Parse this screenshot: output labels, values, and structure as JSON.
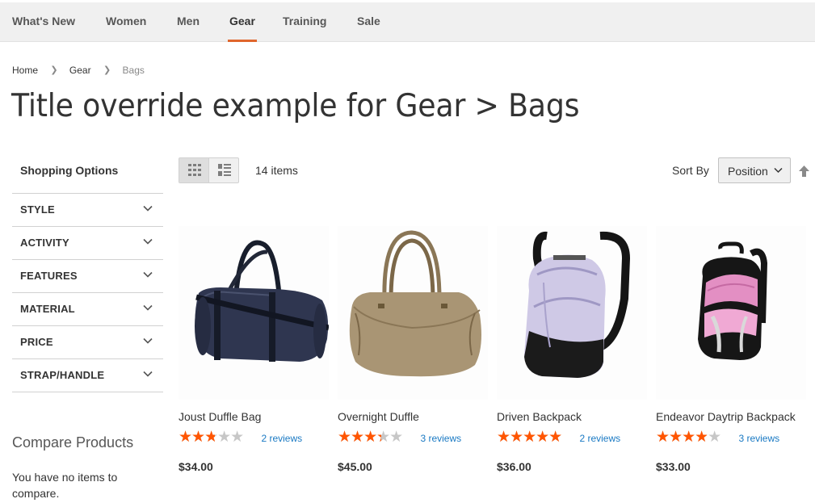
{
  "nav": {
    "items": [
      {
        "label": "What's New"
      },
      {
        "label": "Women"
      },
      {
        "label": "Men"
      },
      {
        "label": "Gear",
        "active": true
      },
      {
        "label": "Training"
      },
      {
        "label": "Sale"
      }
    ]
  },
  "breadcrumbs": [
    "Home",
    "Gear",
    "Bags"
  ],
  "page_title": "Title override example for Gear > Bags",
  "sidebar": {
    "title": "Shopping Options",
    "filters": [
      "STYLE",
      "ACTIVITY",
      "FEATURES",
      "MATERIAL",
      "PRICE",
      "STRAP/HANDLE"
    ],
    "compare_title": "Compare Products",
    "compare_text": "You have no items to compare."
  },
  "toolbar": {
    "modes": [
      "grid-icon",
      "list-icon"
    ],
    "active_mode": "grid",
    "amount": "14 items",
    "sort_label": "Sort By",
    "sort_value": "Position",
    "sort_direction": "ascending"
  },
  "products": [
    {
      "name": "Joust Duffle Bag",
      "rating": 0.5,
      "reviews": "2 reviews",
      "price": "$34.00",
      "image_icon": "duffle-bag-navy"
    },
    {
      "name": "Overnight Duffle",
      "rating": 0.6,
      "reviews": "3 reviews",
      "price": "$45.00",
      "image_icon": "duffle-bag-tan"
    },
    {
      "name": "Driven Backpack",
      "rating": 0.9,
      "reviews": "2 reviews",
      "price": "$36.00",
      "image_icon": "backpack-lavender"
    },
    {
      "name": "Endeavor Daytrip Backpack",
      "rating": 0.7,
      "reviews": "3 reviews",
      "price": "$33.00",
      "image_icon": "backpack-pink"
    }
  ],
  "colors": {
    "accent": "#e0662d",
    "star": "#ff5501",
    "link": "#1979c3"
  }
}
